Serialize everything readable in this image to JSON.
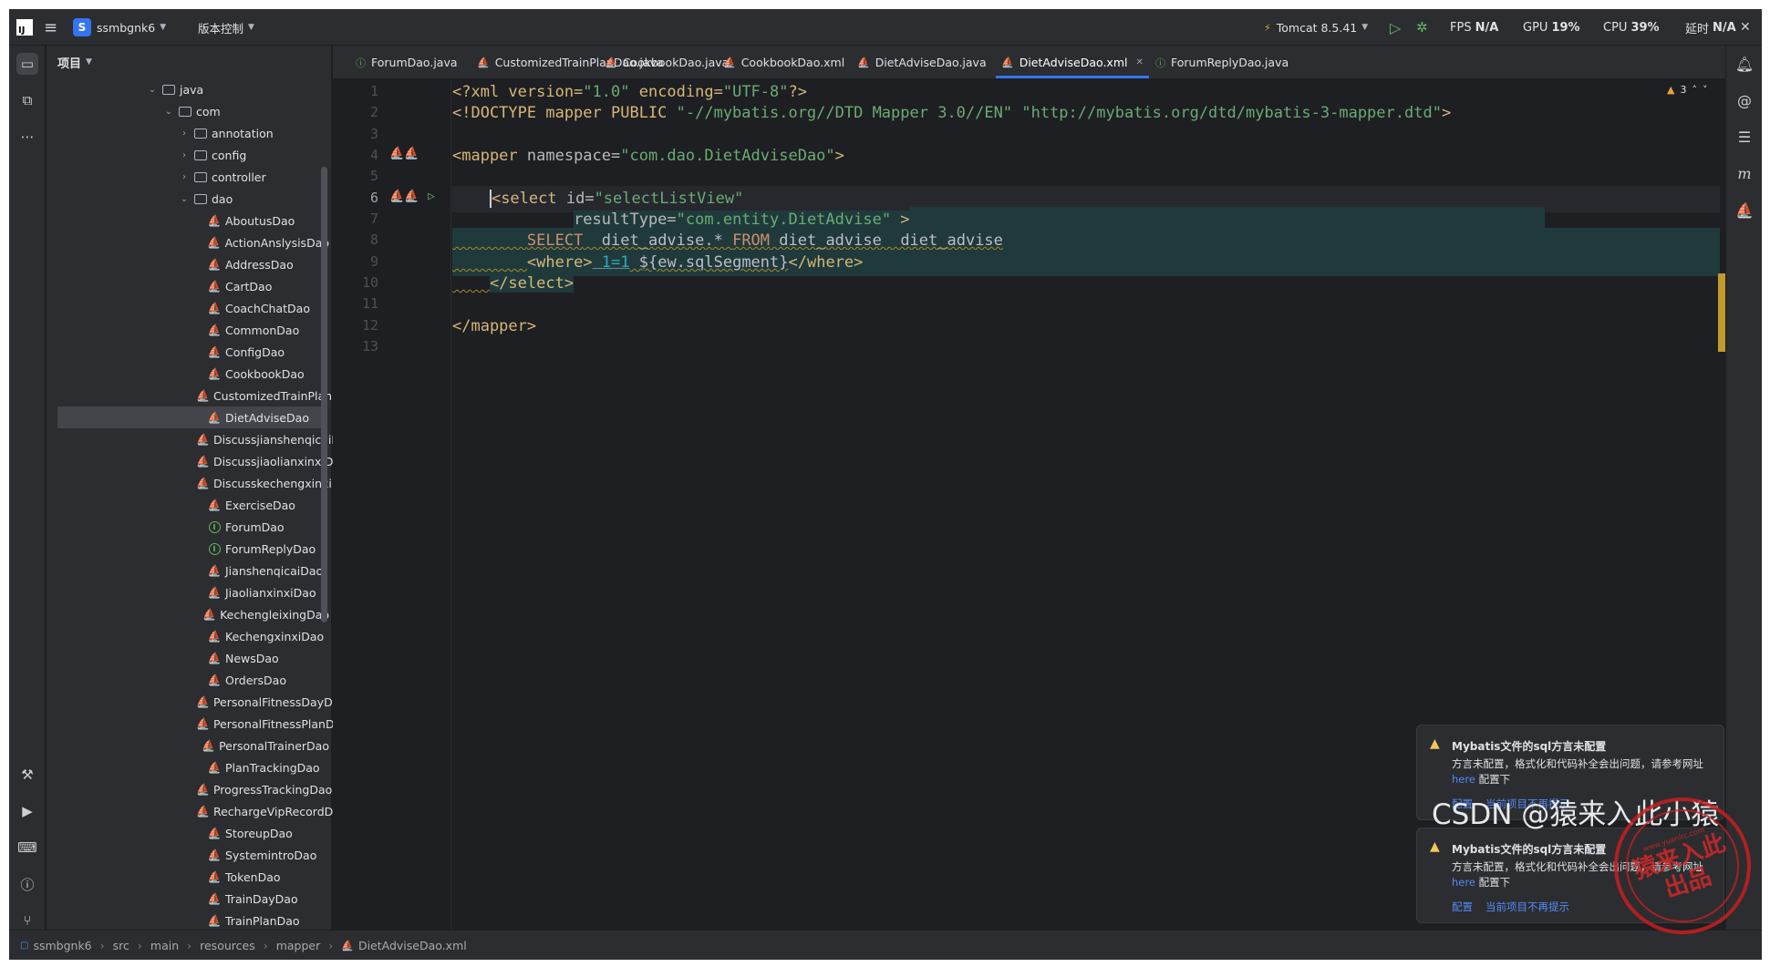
{
  "topbar": {
    "project_initial": "S",
    "project_name": "ssmbgnk6",
    "vcs": "版本控制",
    "run_config": "Tomcat 8.5.41",
    "fps_label": "FPS",
    "fps_value": "N/A",
    "gpu_label": "GPU",
    "gpu_value": "19%",
    "cpu_label": "CPU",
    "cpu_value": "39%",
    "latency_label": "延时",
    "latency_value": "N/A"
  },
  "project_panel": {
    "title": "项目",
    "tree": [
      {
        "label": "java",
        "kind": "folder",
        "depth": 0,
        "arrow": "open"
      },
      {
        "label": "com",
        "kind": "folder",
        "depth": 1,
        "arrow": "open"
      },
      {
        "label": "annotation",
        "kind": "folder",
        "depth": 2,
        "arrow": "closed"
      },
      {
        "label": "config",
        "kind": "folder",
        "depth": 2,
        "arrow": "closed"
      },
      {
        "label": "controller",
        "kind": "folder",
        "depth": 2,
        "arrow": "closed"
      },
      {
        "label": "dao",
        "kind": "folder",
        "depth": 2,
        "arrow": "open"
      },
      {
        "label": "AboutusDao",
        "kind": "mapper",
        "depth": 3
      },
      {
        "label": "ActionAnslysisDao",
        "kind": "mapper",
        "depth": 3
      },
      {
        "label": "AddressDao",
        "kind": "mapper",
        "depth": 3
      },
      {
        "label": "CartDao",
        "kind": "mapper",
        "depth": 3
      },
      {
        "label": "CoachChatDao",
        "kind": "mapper",
        "depth": 3
      },
      {
        "label": "CommonDao",
        "kind": "mapper",
        "depth": 3
      },
      {
        "label": "ConfigDao",
        "kind": "mapper",
        "depth": 3
      },
      {
        "label": "CookbookDao",
        "kind": "mapper",
        "depth": 3
      },
      {
        "label": "CustomizedTrainPlanDao",
        "kind": "mapper",
        "depth": 3
      },
      {
        "label": "DietAdviseDao",
        "kind": "mapper",
        "depth": 3,
        "selected": true
      },
      {
        "label": "DiscussjianshenqicaiDao",
        "kind": "mapper",
        "depth": 3
      },
      {
        "label": "DiscussjiaolianxinxiDao",
        "kind": "mapper",
        "depth": 3
      },
      {
        "label": "DiscusskechengxinxiDao",
        "kind": "mapper",
        "depth": 3
      },
      {
        "label": "ExerciseDao",
        "kind": "mapper",
        "depth": 3
      },
      {
        "label": "ForumDao",
        "kind": "interface",
        "depth": 3
      },
      {
        "label": "ForumReplyDao",
        "kind": "interface",
        "depth": 3
      },
      {
        "label": "JianshenqicaiDao",
        "kind": "mapper",
        "depth": 3
      },
      {
        "label": "JiaolianxinxiDao",
        "kind": "mapper",
        "depth": 3
      },
      {
        "label": "KechengleixingDao",
        "kind": "mapper",
        "depth": 3
      },
      {
        "label": "KechengxinxiDao",
        "kind": "mapper",
        "depth": 3
      },
      {
        "label": "NewsDao",
        "kind": "mapper",
        "depth": 3
      },
      {
        "label": "OrdersDao",
        "kind": "mapper",
        "depth": 3
      },
      {
        "label": "PersonalFitnessDayDao",
        "kind": "mapper",
        "depth": 3
      },
      {
        "label": "PersonalFitnessPlanDao",
        "kind": "mapper",
        "depth": 3
      },
      {
        "label": "PersonalTrainerDao",
        "kind": "mapper",
        "depth": 3
      },
      {
        "label": "PlanTrackingDao",
        "kind": "mapper",
        "depth": 3
      },
      {
        "label": "ProgressTrackingDao",
        "kind": "mapper",
        "depth": 3
      },
      {
        "label": "RechargeVipRecordDao",
        "kind": "mapper",
        "depth": 3
      },
      {
        "label": "StoreupDao",
        "kind": "mapper",
        "depth": 3
      },
      {
        "label": "SystemintroDao",
        "kind": "mapper",
        "depth": 3
      },
      {
        "label": "TokenDao",
        "kind": "mapper",
        "depth": 3
      },
      {
        "label": "TrainDayDao",
        "kind": "mapper",
        "depth": 3
      },
      {
        "label": "TrainPlanDao",
        "kind": "mapper",
        "depth": 3
      }
    ]
  },
  "tabs": [
    {
      "label": "ForumDao.java",
      "icon": "interface-icon"
    },
    {
      "label": "CustomizedTrainPlanDao.java",
      "icon": "mapper-icon"
    },
    {
      "label": "CookbookDao.java",
      "icon": "mapper-icon"
    },
    {
      "label": "CookbookDao.xml",
      "icon": "mybatis-xml-icon"
    },
    {
      "label": "DietAdviseDao.java",
      "icon": "mapper-icon"
    },
    {
      "label": "DietAdviseDao.xml",
      "icon": "mybatis-xml-icon",
      "active": true,
      "closable": true
    },
    {
      "label": "ForumReplyDao.java",
      "icon": "interface-icon"
    }
  ],
  "editor": {
    "warning_count": "3",
    "line_numbers": [
      "1",
      "2",
      "3",
      "4",
      "5",
      "6",
      "7",
      "8",
      "9",
      "10",
      "11",
      "12",
      "13"
    ],
    "current_line": "6",
    "code": {
      "l1_a": "<?xml version=",
      "l1_b": "\"1.0\"",
      "l1_c": " encoding=",
      "l1_d": "\"UTF-8\"",
      "l1_e": "?>",
      "l2_a": "<!DOCTYPE mapper PUBLIC ",
      "l2_b": "\"-//mybatis.org//DTD Mapper 3.0//EN\"",
      "l2_c": " ",
      "l2_d": "\"http://mybatis.org/dtd/mybatis-3-mapper.dtd\"",
      "l2_e": ">",
      "l4_a": "<mapper",
      "l4_b": " namespace=",
      "l4_c": "\"com.dao.DietAdviseDao\"",
      "l4_d": ">",
      "l6_a": "<select",
      "l6_b": " id=",
      "l6_c": "\"selectListView\"",
      "l7_a": "resultType=",
      "l7_b": "\"com.entity.DietAdvise\"",
      "l7_c": " >",
      "l8_a": "SELECT",
      "l8_b": "  diet_advise.* ",
      "l8_c": "FROM",
      "l8_d": " diet_advise  diet_advise",
      "l9_a": "<where>",
      "l9_b": " 1=1",
      "l9_c": " ${ew.sqlSegment}",
      "l9_d": "</where>",
      "l10_a": "</select>",
      "l12_a": "</mapper>"
    }
  },
  "notifications": [
    {
      "title": "Mybatis文件的sql方言未配置",
      "body": "方言未配置，格式化和代码补全会出问题，请参考网址",
      "link": "here",
      "after_link": " 配置下",
      "action1": "配置",
      "action2": "当前项目不再提示"
    },
    {
      "title": "Mybatis文件的sql方言未配置",
      "body": "方言未配置，格式化和代码补全会出问题，请参考网址",
      "link": "here",
      "after_link": " 配置下",
      "action1": "配置",
      "action2": "当前项目不再提示"
    }
  ],
  "statusbar": {
    "breadcrumbs": [
      "ssmbgnk6",
      "src",
      "main",
      "resources",
      "mapper",
      "DietAdviseDao.xml"
    ]
  },
  "watermark": {
    "text": "CSDN @猿来入此小猿",
    "stamp_line1": "猿来入此",
    "stamp_line2": "出品",
    "stamp_url": "www.yuanlrc.com"
  }
}
